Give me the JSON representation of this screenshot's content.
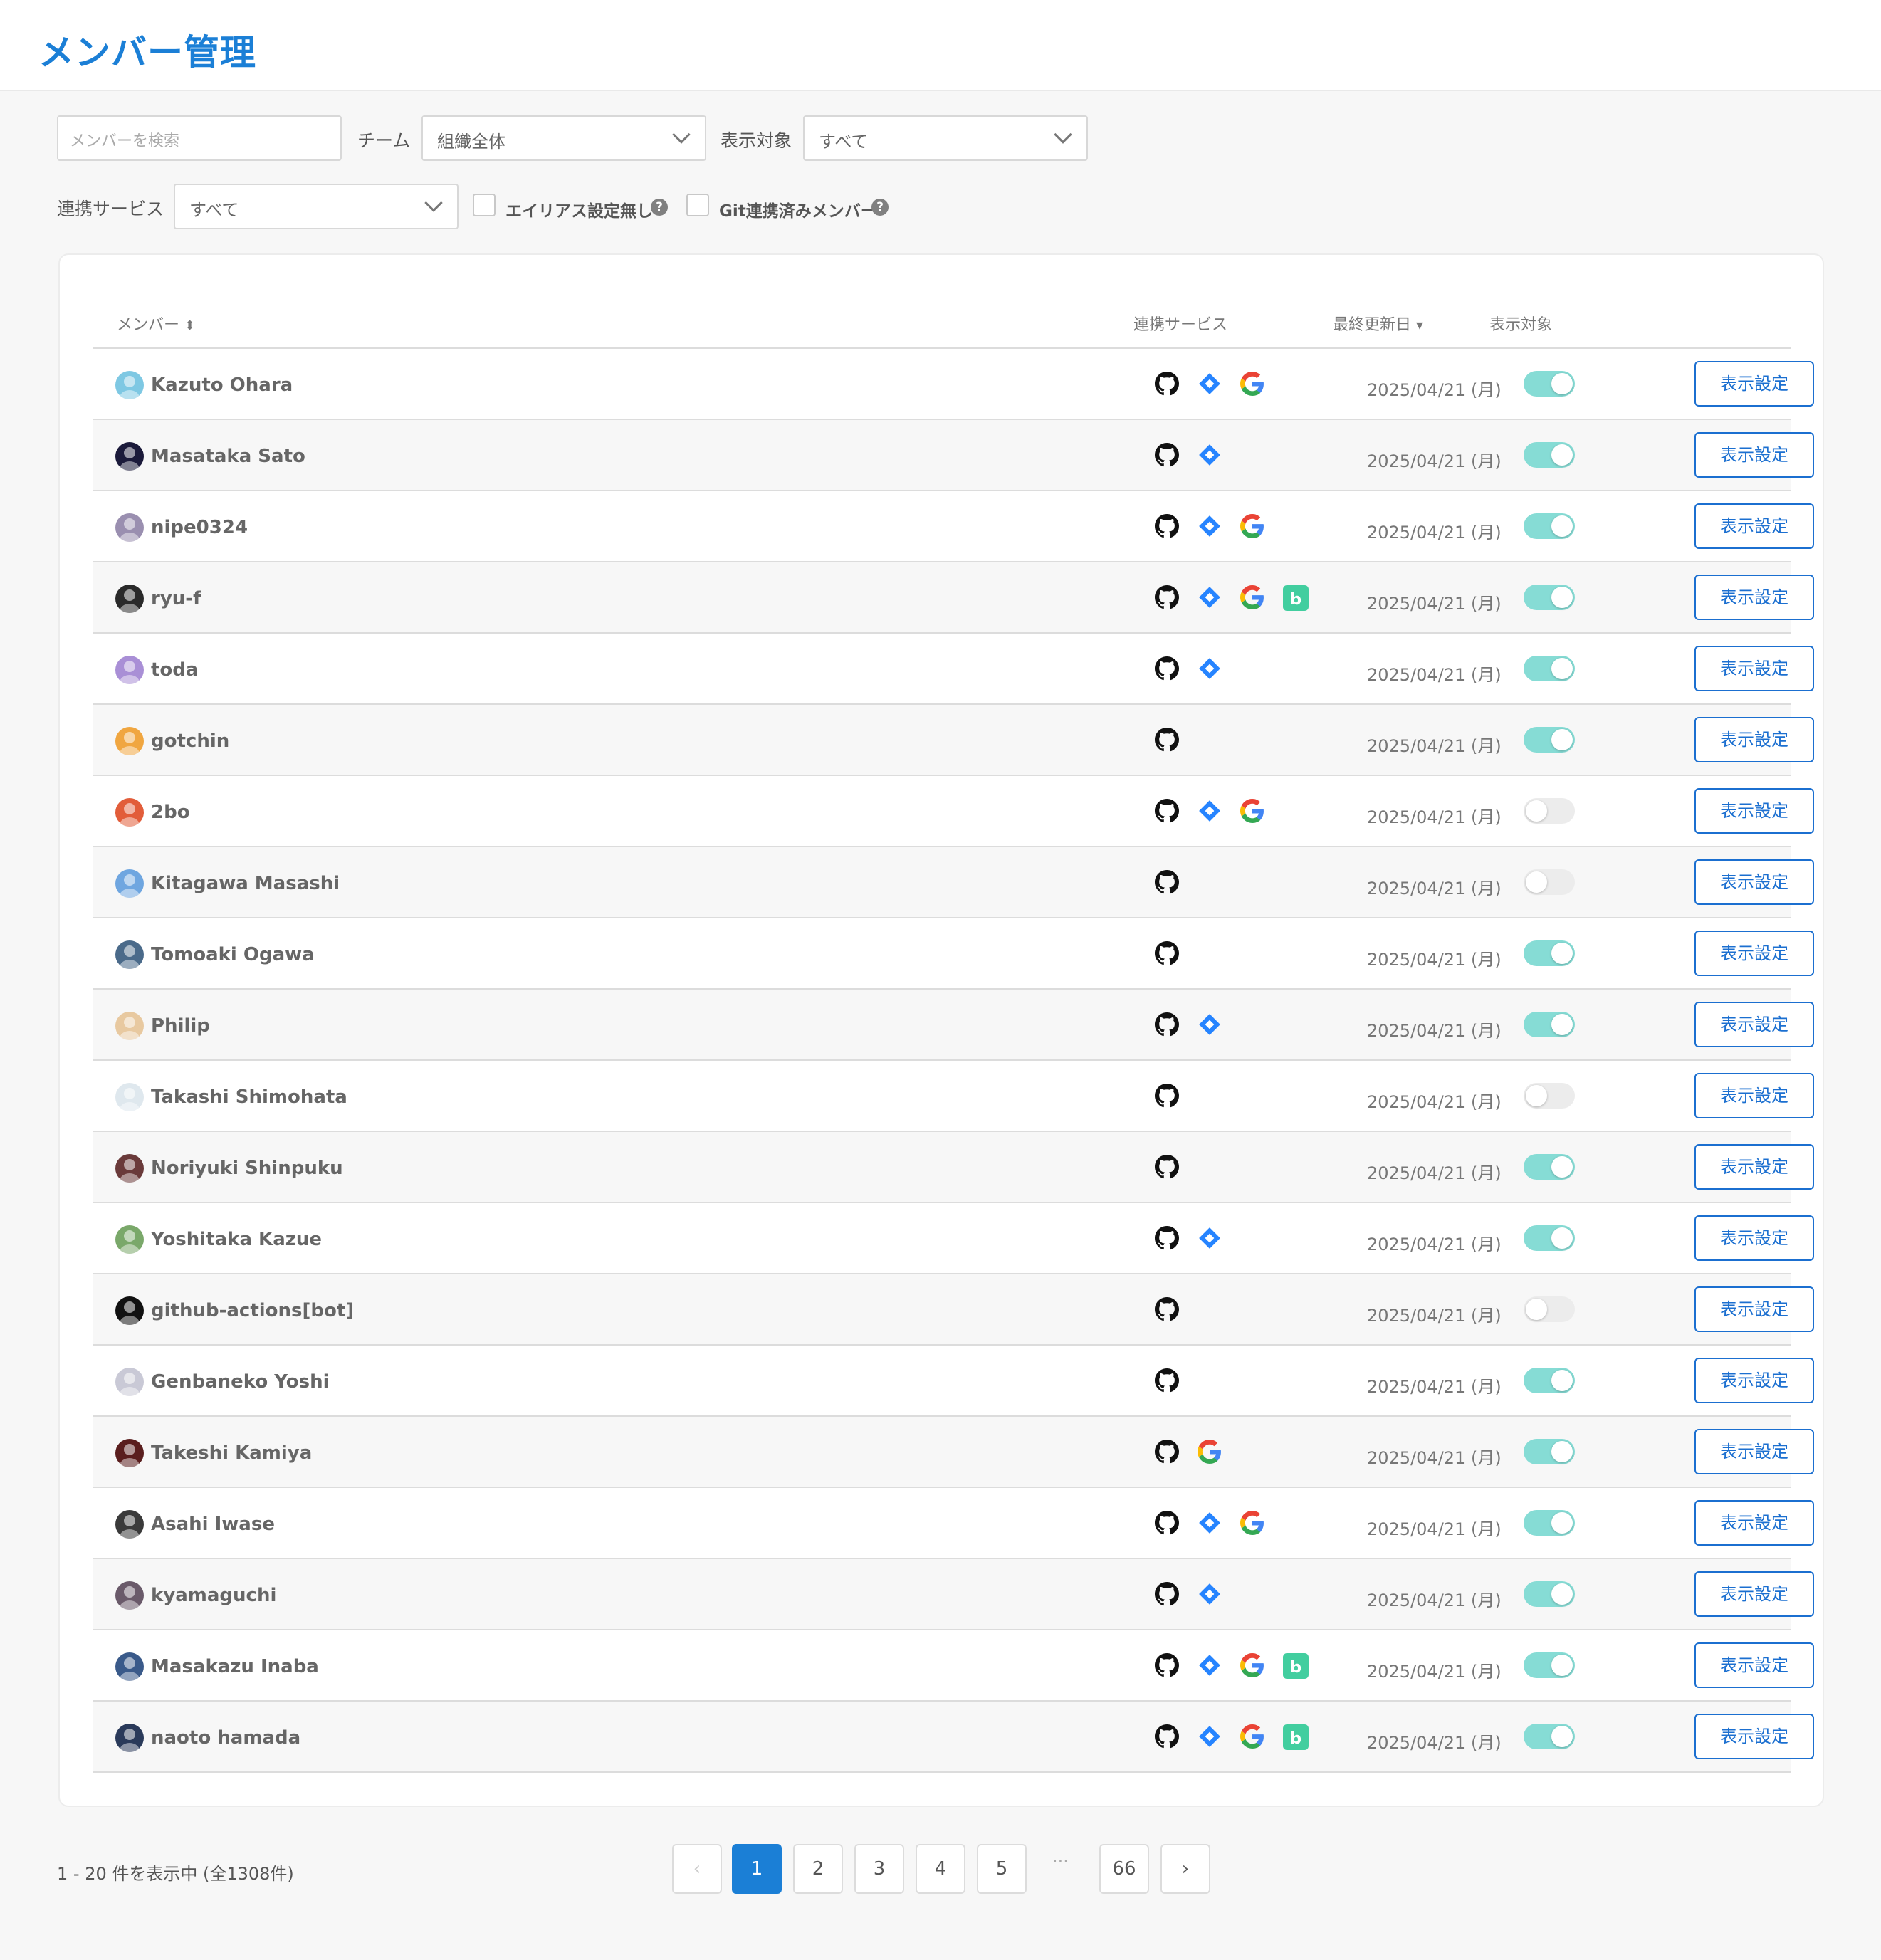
{
  "page": {
    "title": "メンバー管理"
  },
  "filters": {
    "search_placeholder": "メンバーを検索",
    "team_label": "チーム",
    "team_value": "組織全体",
    "display_label": "表示対象",
    "display_value": "すべて",
    "service_label": "連携サービス",
    "service_value": "すべて",
    "no_alias_label": "エイリアス設定無し",
    "git_linked_label": "Git連携済みメンバー",
    "help_glyph": "?"
  },
  "table": {
    "headers": {
      "member": "メンバー",
      "member_sort": "⬍",
      "services": "連携サービス",
      "updated": "最終更新日",
      "updated_sort": "▾",
      "display": "表示対象"
    },
    "button_label": "表示設定",
    "rows": [
      {
        "name": "Kazuto Ohara",
        "services": [
          "github",
          "jira",
          "google"
        ],
        "date": "2025/04/21 (月)",
        "display": true,
        "avatar_color": "#7ec8e3"
      },
      {
        "name": "Masataka Sato",
        "services": [
          "github",
          "jira"
        ],
        "date": "2025/04/21 (月)",
        "display": true,
        "avatar_color": "#1b1a3a"
      },
      {
        "name": "nipe0324",
        "services": [
          "github",
          "jira",
          "google"
        ],
        "date": "2025/04/21 (月)",
        "display": true,
        "avatar_color": "#9a8fb0"
      },
      {
        "name": "ryu-f",
        "services": [
          "github",
          "jira",
          "google",
          "backlog"
        ],
        "date": "2025/04/21 (月)",
        "display": true,
        "avatar_color": "#2a2a2a"
      },
      {
        "name": "toda",
        "services": [
          "github",
          "jira"
        ],
        "date": "2025/04/21 (月)",
        "display": true,
        "avatar_color": "#a98fd6"
      },
      {
        "name": "gotchin",
        "services": [
          "github"
        ],
        "date": "2025/04/21 (月)",
        "display": true,
        "avatar_color": "#f0a640"
      },
      {
        "name": "2bo",
        "services": [
          "github",
          "jira",
          "google"
        ],
        "date": "2025/04/21 (月)",
        "display": false,
        "avatar_color": "#e25d3a"
      },
      {
        "name": "Kitagawa Masashi",
        "services": [
          "github"
        ],
        "date": "2025/04/21 (月)",
        "display": false,
        "avatar_color": "#6fa6e0"
      },
      {
        "name": "Tomoaki Ogawa",
        "services": [
          "github"
        ],
        "date": "2025/04/21 (月)",
        "display": true,
        "avatar_color": "#4a6a8a"
      },
      {
        "name": "Philip",
        "services": [
          "github",
          "jira"
        ],
        "date": "2025/04/21 (月)",
        "display": true,
        "avatar_color": "#e8c9a0"
      },
      {
        "name": "Takashi Shimohata",
        "services": [
          "github"
        ],
        "date": "2025/04/21 (月)",
        "display": false,
        "avatar_color": "#dfe8ee"
      },
      {
        "name": "Noriyuki Shinpuku",
        "services": [
          "github"
        ],
        "date": "2025/04/21 (月)",
        "display": true,
        "avatar_color": "#6a3a3a"
      },
      {
        "name": "Yoshitaka Kazue",
        "services": [
          "github",
          "jira"
        ],
        "date": "2025/04/21 (月)",
        "display": true,
        "avatar_color": "#7aa86a"
      },
      {
        "name": "github-actions[bot]",
        "services": [
          "github"
        ],
        "date": "2025/04/21 (月)",
        "display": false,
        "avatar_color": "#111111"
      },
      {
        "name": "Genbaneko Yoshi",
        "services": [
          "github"
        ],
        "date": "2025/04/21 (月)",
        "display": true,
        "avatar_color": "#c9c9d6"
      },
      {
        "name": "Takeshi Kamiya",
        "services": [
          "github",
          "google"
        ],
        "date": "2025/04/21 (月)",
        "display": true,
        "avatar_color": "#5a1e1e"
      },
      {
        "name": "Asahi Iwase",
        "services": [
          "github",
          "jira",
          "google"
        ],
        "date": "2025/04/21 (月)",
        "display": true,
        "avatar_color": "#3a3a3a"
      },
      {
        "name": "kyamaguchi",
        "services": [
          "github",
          "jira"
        ],
        "date": "2025/04/21 (月)",
        "display": true,
        "avatar_color": "#6a5a6a"
      },
      {
        "name": "Masakazu Inaba",
        "services": [
          "github",
          "jira",
          "google",
          "backlog"
        ],
        "date": "2025/04/21 (月)",
        "display": true,
        "avatar_color": "#3a5a8a"
      },
      {
        "name": "naoto hamada",
        "services": [
          "github",
          "jira",
          "google",
          "backlog"
        ],
        "date": "2025/04/21 (月)",
        "display": true,
        "avatar_color": "#2a3a5a"
      }
    ]
  },
  "pagination": {
    "info": "1 - 20 件を表示中 (全1308件)",
    "prev": "‹",
    "pages": [
      "1",
      "2",
      "3",
      "4",
      "5"
    ],
    "ellipsis": "···",
    "last": "66",
    "next": "›",
    "current": "1"
  },
  "colors": {
    "accent": "#1b7fd6",
    "toggle_on": "#86dcd5",
    "jira": "#2684ff",
    "backlog": "#42ce9f"
  }
}
